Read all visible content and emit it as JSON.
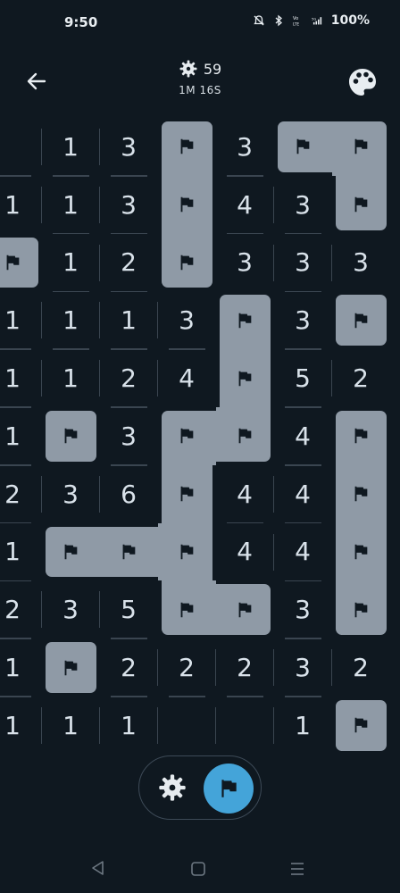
{
  "status_bar": {
    "time": "9:50",
    "battery": "100%",
    "icons": [
      "mute-icon",
      "bluetooth-icon",
      "volte-icon",
      "5g-signal-icon",
      "battery-icon"
    ]
  },
  "header": {
    "mines_remaining": "59",
    "timer": "1M 16S",
    "back_icon": "arrow-left-icon",
    "palette_icon": "palette-icon"
  },
  "board": {
    "columns": 7,
    "rows": 11,
    "note": "E = blank revealed cell, F = flagged cell, digits = neighbor mine count; leftmost and rightmost columns are partially cut off",
    "cells": [
      [
        "E",
        "1",
        "3",
        "F",
        "3",
        "F",
        "F"
      ],
      [
        "1",
        "1",
        "3",
        "F",
        "4",
        "3",
        "F"
      ],
      [
        "F",
        "1",
        "2",
        "F",
        "3",
        "3",
        "3"
      ],
      [
        "1",
        "1",
        "1",
        "3",
        "F",
        "3",
        "F"
      ],
      [
        "1",
        "1",
        "2",
        "4",
        "F",
        "5",
        "2"
      ],
      [
        "1",
        "F",
        "3",
        "F",
        "F",
        "4",
        "F"
      ],
      [
        "2",
        "3",
        "6",
        "F",
        "4",
        "4",
        "F"
      ],
      [
        "1",
        "F",
        "F",
        "F",
        "4",
        "4",
        "F"
      ],
      [
        "2",
        "3",
        "5",
        "F",
        "F",
        "3",
        "F"
      ],
      [
        "1",
        "F",
        "2",
        "2",
        "2",
        "3",
        "2"
      ],
      [
        "1",
        "1",
        "1",
        "E",
        "E",
        "1",
        "F"
      ]
    ],
    "flag_color": "#8f9aa6",
    "number_color": "#d9e2ea"
  },
  "toolbar": {
    "reveal_mode_icon": "mine-icon",
    "flag_mode_icon": "flag-icon",
    "active_mode": "flag",
    "active_color": "#44a4d9"
  },
  "nav_bar": {
    "icons": [
      "nav-back-icon",
      "nav-home-icon",
      "nav-recents-icon"
    ]
  }
}
